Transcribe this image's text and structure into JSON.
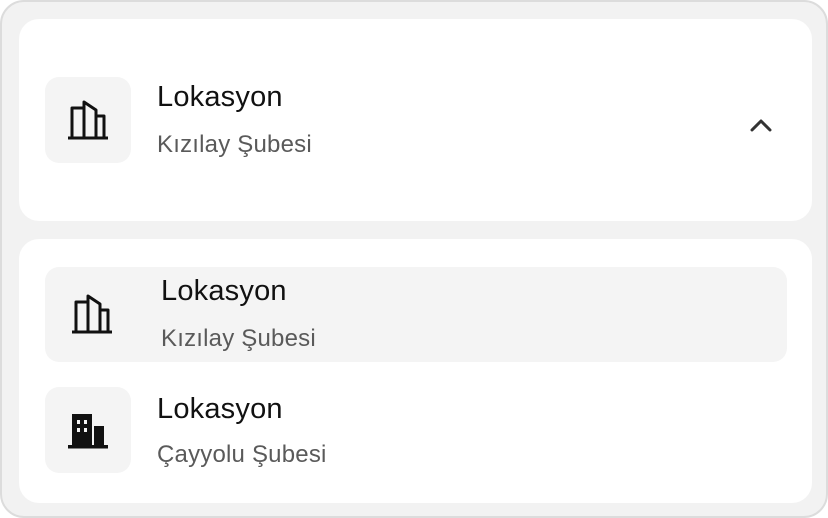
{
  "selector": {
    "title": "Lokasyon",
    "selected_value": "Kızılay Şubesi",
    "icon": "building-outline-icon",
    "expanded": true,
    "toggle_icon": "chevron-up-icon"
  },
  "options": [
    {
      "title": "Lokasyon",
      "value": "Kızılay Şubesi",
      "icon": "building-outline-icon",
      "selected": true
    },
    {
      "title": "Lokasyon",
      "value": "Çayyolu Şubesi",
      "icon": "building-filled-icon",
      "selected": false
    }
  ],
  "colors": {
    "background": "#f2f2f2",
    "card": "#ffffff",
    "icon_tile": "#f4f4f4",
    "text_primary": "#111111",
    "text_secondary": "#5a5a5a"
  }
}
